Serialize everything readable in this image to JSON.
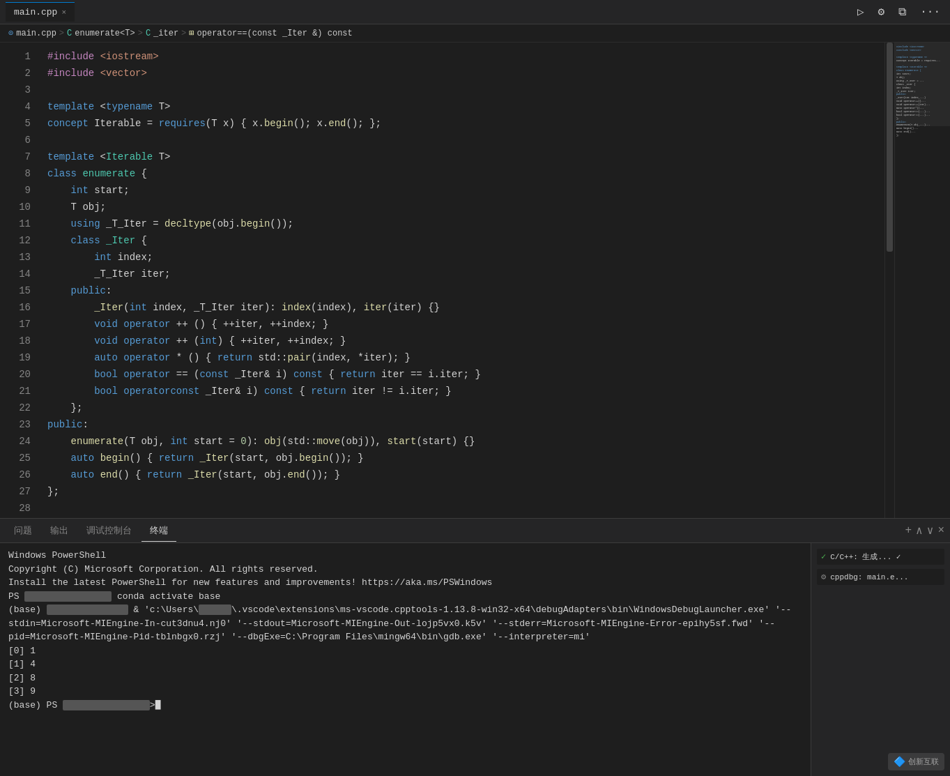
{
  "titleBar": {
    "tab": "main.cpp",
    "closeIcon": "×",
    "runIcon": "▷",
    "settingsIcon": "⚙",
    "splitIcon": "⧉",
    "moreIcon": "···"
  },
  "breadcrumb": {
    "parts": [
      "main.cpp",
      "enumerate<T>",
      "_iter",
      "operator==(const _Iter &) const"
    ]
  },
  "code": {
    "lines": [
      {
        "num": "1",
        "tokens": [
          {
            "t": "pp",
            "v": "#include"
          },
          {
            "t": "op",
            "v": " "
          },
          {
            "t": "inc",
            "v": "<iostream>"
          }
        ]
      },
      {
        "num": "2",
        "tokens": [
          {
            "t": "pp",
            "v": "#include"
          },
          {
            "t": "op",
            "v": " "
          },
          {
            "t": "inc",
            "v": "<vector>"
          }
        ]
      },
      {
        "num": "3",
        "tokens": []
      },
      {
        "num": "4",
        "tokens": [
          {
            "t": "kw",
            "v": "template"
          },
          {
            "t": "op",
            "v": " <"
          },
          {
            "t": "kw",
            "v": "typename"
          },
          {
            "t": "op",
            "v": " T>"
          }
        ]
      },
      {
        "num": "5",
        "tokens": [
          {
            "t": "kw",
            "v": "concept"
          },
          {
            "t": "op",
            "v": " Iterable = "
          },
          {
            "t": "kw",
            "v": "requires"
          },
          {
            "t": "op",
            "v": "(T x) { x."
          },
          {
            "t": "fn",
            "v": "begin"
          },
          {
            "t": "op",
            "v": "(); x."
          },
          {
            "t": "fn",
            "v": "end"
          },
          {
            "t": "op",
            "v": "(); };"
          }
        ]
      },
      {
        "num": "6",
        "tokens": []
      },
      {
        "num": "7",
        "tokens": [
          {
            "t": "kw",
            "v": "template"
          },
          {
            "t": "op",
            "v": " <"
          },
          {
            "t": "type",
            "v": "Iterable"
          },
          {
            "t": "op",
            "v": " T>"
          }
        ]
      },
      {
        "num": "8",
        "tokens": [
          {
            "t": "kw",
            "v": "class"
          },
          {
            "t": "op",
            "v": " "
          },
          {
            "t": "type",
            "v": "enumerate"
          },
          {
            "t": "op",
            "v": " {"
          }
        ]
      },
      {
        "num": "9",
        "tokens": [
          {
            "t": "op",
            "v": "    "
          },
          {
            "t": "kw",
            "v": "int"
          },
          {
            "t": "op",
            "v": " start;"
          }
        ]
      },
      {
        "num": "10",
        "tokens": [
          {
            "t": "op",
            "v": "    T obj;"
          }
        ]
      },
      {
        "num": "11",
        "tokens": [
          {
            "t": "op",
            "v": "    "
          },
          {
            "t": "kw",
            "v": "using"
          },
          {
            "t": "op",
            "v": " _T_Iter = "
          },
          {
            "t": "fn",
            "v": "decltype"
          },
          {
            "t": "op",
            "v": "(obj."
          },
          {
            "t": "fn",
            "v": "begin"
          },
          {
            "t": "op",
            "v": "());"
          }
        ]
      },
      {
        "num": "12",
        "tokens": [
          {
            "t": "op",
            "v": "    "
          },
          {
            "t": "kw",
            "v": "class"
          },
          {
            "t": "op",
            "v": " "
          },
          {
            "t": "type",
            "v": "_Iter"
          },
          {
            "t": "op",
            "v": " {"
          }
        ]
      },
      {
        "num": "13",
        "tokens": [
          {
            "t": "op",
            "v": "        "
          },
          {
            "t": "kw",
            "v": "int"
          },
          {
            "t": "op",
            "v": " index;"
          }
        ]
      },
      {
        "num": "14",
        "tokens": [
          {
            "t": "op",
            "v": "        _T_Iter iter;"
          }
        ]
      },
      {
        "num": "15",
        "tokens": [
          {
            "t": "op",
            "v": "    "
          },
          {
            "t": "kw",
            "v": "public"
          },
          {
            "t": "op",
            "v": ":"
          }
        ]
      },
      {
        "num": "16",
        "tokens": [
          {
            "t": "op",
            "v": "        "
          },
          {
            "t": "fn",
            "v": "_Iter"
          },
          {
            "t": "op",
            "v": "("
          },
          {
            "t": "kw",
            "v": "int"
          },
          {
            "t": "op",
            "v": " index, _T_Iter iter): "
          },
          {
            "t": "fn",
            "v": "index"
          },
          {
            "t": "op",
            "v": "(index), "
          },
          {
            "t": "fn",
            "v": "iter"
          },
          {
            "t": "op",
            "v": "(iter) {}"
          }
        ]
      },
      {
        "num": "17",
        "tokens": [
          {
            "t": "op",
            "v": "        "
          },
          {
            "t": "kw",
            "v": "void"
          },
          {
            "t": "op",
            "v": " "
          },
          {
            "t": "kw",
            "v": "operator"
          },
          {
            "t": "op",
            "v": " ++ () { ++iter, ++index; }"
          }
        ]
      },
      {
        "num": "18",
        "tokens": [
          {
            "t": "op",
            "v": "        "
          },
          {
            "t": "kw",
            "v": "void"
          },
          {
            "t": "op",
            "v": " "
          },
          {
            "t": "kw",
            "v": "operator"
          },
          {
            "t": "op",
            "v": " ++ ("
          },
          {
            "t": "kw",
            "v": "int"
          },
          {
            "t": "op",
            "v": ") { ++iter, ++index; }"
          }
        ]
      },
      {
        "num": "19",
        "tokens": [
          {
            "t": "op",
            "v": "        "
          },
          {
            "t": "kw",
            "v": "auto"
          },
          {
            "t": "op",
            "v": " "
          },
          {
            "t": "kw",
            "v": "operator"
          },
          {
            "t": "op",
            "v": " * () { "
          },
          {
            "t": "kw",
            "v": "return"
          },
          {
            "t": "op",
            "v": " std::"
          },
          {
            "t": "fn",
            "v": "pair"
          },
          {
            "t": "op",
            "v": "(index, *iter); }"
          }
        ]
      },
      {
        "num": "20",
        "tokens": [
          {
            "t": "op",
            "v": "        "
          },
          {
            "t": "kw",
            "v": "bool"
          },
          {
            "t": "op",
            "v": " "
          },
          {
            "t": "kw",
            "v": "operator"
          },
          {
            "t": "op",
            "v": " == ("
          },
          {
            "t": "kw",
            "v": "const"
          },
          {
            "t": "op",
            "v": " _Iter& i) "
          },
          {
            "t": "kw",
            "v": "const"
          },
          {
            "t": "op",
            "v": " { "
          },
          {
            "t": "kw",
            "v": "return"
          },
          {
            "t": "op",
            "v": " iter == i.iter; }"
          }
        ]
      },
      {
        "num": "21",
        "tokens": [
          {
            "t": "op",
            "v": "        "
          },
          {
            "t": "kw",
            "v": "bool"
          },
          {
            "t": "op",
            "v": " "
          },
          {
            "t": "kw",
            "v": "operator"
          },
          {
            "t": "op",
            " v": " != ("
          },
          {
            "t": "kw",
            "v": "const"
          },
          {
            "t": "op",
            "v": " _Iter& i) "
          },
          {
            "t": "kw",
            "v": "const"
          },
          {
            "t": "op",
            "v": " { "
          },
          {
            "t": "kw",
            "v": "return"
          },
          {
            "t": "op",
            "v": " iter != i.iter; }"
          }
        ]
      },
      {
        "num": "22",
        "tokens": [
          {
            "t": "op",
            "v": "    };"
          }
        ]
      },
      {
        "num": "23",
        "tokens": [
          {
            "t": "kw",
            "v": "public"
          },
          {
            "t": "op",
            "v": ":"
          }
        ]
      },
      {
        "num": "24",
        "tokens": [
          {
            "t": "op",
            "v": "    "
          },
          {
            "t": "fn",
            "v": "enumerate"
          },
          {
            "t": "op",
            "v": "(T obj, "
          },
          {
            "t": "kw",
            "v": "int"
          },
          {
            "t": "op",
            "v": " start = "
          },
          {
            "t": "num",
            "v": "0"
          },
          {
            "t": "op",
            "v": "): "
          },
          {
            "t": "fn",
            "v": "obj"
          },
          {
            "t": "op",
            "v": "(std::"
          },
          {
            "t": "fn",
            "v": "move"
          },
          {
            "t": "op",
            "v": "(obj)), "
          },
          {
            "t": "fn",
            "v": "start"
          },
          {
            "t": "op",
            "v": "(start) {}"
          }
        ]
      },
      {
        "num": "25",
        "tokens": [
          {
            "t": "op",
            "v": "    "
          },
          {
            "t": "kw",
            "v": "auto"
          },
          {
            "t": "op",
            "v": " "
          },
          {
            "t": "fn",
            "v": "begin"
          },
          {
            "t": "op",
            "v": "() { "
          },
          {
            "t": "kw",
            "v": "return"
          },
          {
            "t": "op",
            "v": " "
          },
          {
            "t": "fn",
            "v": "_Iter"
          },
          {
            "t": "op",
            "v": "(start, obj."
          },
          {
            "t": "fn",
            "v": "begin"
          },
          {
            "t": "op",
            "v": "()); }"
          }
        ]
      },
      {
        "num": "26",
        "tokens": [
          {
            "t": "op",
            "v": "    "
          },
          {
            "t": "kw",
            "v": "auto"
          },
          {
            "t": "op",
            "v": " "
          },
          {
            "t": "fn",
            "v": "end"
          },
          {
            "t": "op",
            "v": "() { "
          },
          {
            "t": "kw",
            "v": "return"
          },
          {
            "t": "op",
            "v": " "
          },
          {
            "t": "fn",
            "v": "_Iter"
          },
          {
            "t": "op",
            "v": "(start, obj."
          },
          {
            "t": "fn",
            "v": "end"
          },
          {
            "t": "op",
            "v": "()); }"
          }
        ]
      },
      {
        "num": "27",
        "tokens": [
          {
            "t": "op",
            "v": "};"
          }
        ]
      },
      {
        "num": "28",
        "tokens": []
      }
    ]
  },
  "terminal": {
    "tabs": [
      "问题",
      "输出",
      "调试控制台",
      "终端"
    ],
    "activeTab": "终端",
    "actions": [
      "+",
      "∧",
      "∨",
      "×"
    ],
    "output": [
      "Windows PowerShell",
      "Copyright (C) Microsoft Corporation. All rights reserved.",
      "",
      "Install the latest PowerShell for new features and improvements! https://aka.ms/PSWindows",
      "",
      "PS [blurred] conda activate base",
      "(base) [blurred] & 'c:\\Users\\[blurred]\\.vscode\\extensions\\ms-vscode.cpptools-1.13.8-win32-x64\\debugAdapters\\bin\\WindowsDebugLauncher.exe' '--stdin=Microsoft-MIEngine-In-cut3dnu4.nj0' '--stdout=Microsoft-MIEngine-Out-lojp5vx0.k5v' '--stderr=Microsoft-MIEngine-Error-epihy5sf.fwd' '--pid=Microsoft-MIEngine-Pid-tblnbgx0.rzj' '--dbgExe=C:\\Program Files\\mingw64\\bin\\gdb.exe' '--interpreter=mi'",
      "[0] 1",
      "[1] 4",
      "[2] 8",
      "[3] 9",
      "(base) PS [blurred]>"
    ],
    "sideItems": [
      {
        "icon": "✓",
        "label": "C/C++: 生成...",
        "iconColor": "#4caf50"
      },
      {
        "icon": "⚙",
        "label": "cppdbg: main.e...",
        "iconColor": "#888"
      }
    ]
  },
  "watermark": "创新互联"
}
